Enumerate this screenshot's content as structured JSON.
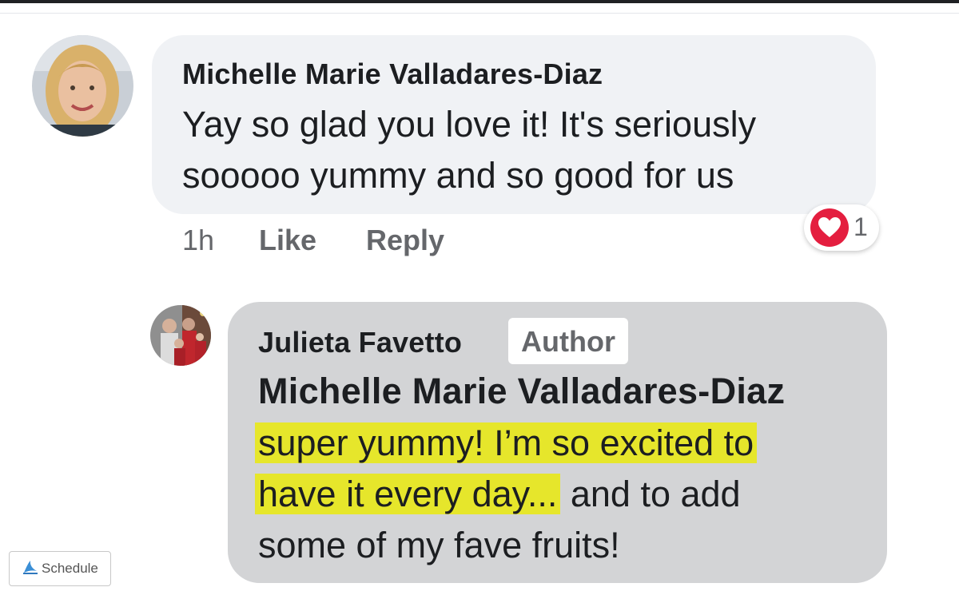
{
  "comment": {
    "author": "Michelle Marie Valladares-Diaz",
    "lines": [
      "Yay so glad you love it! It's seriously",
      "sooooo yummy and so good for us"
    ],
    "time": "1h",
    "like_label": "Like",
    "reply_label": "Reply",
    "reaction": {
      "icon": "heart-icon",
      "count": "1",
      "color": "#e41e3f"
    }
  },
  "reply": {
    "author": "Julieta Favetto",
    "badge": "Author",
    "mention": "Michelle Marie Valladares-Diaz",
    "line1": "super yummy! I’m so excited to",
    "line2_highlight": "have it every day...",
    "line2_rest": " and to add",
    "line3": "some of my fave fruits!",
    "highlight_color": "#e6e62b"
  },
  "schedule_button": {
    "label": "Schedule",
    "icon": "schedule-logo-icon"
  }
}
